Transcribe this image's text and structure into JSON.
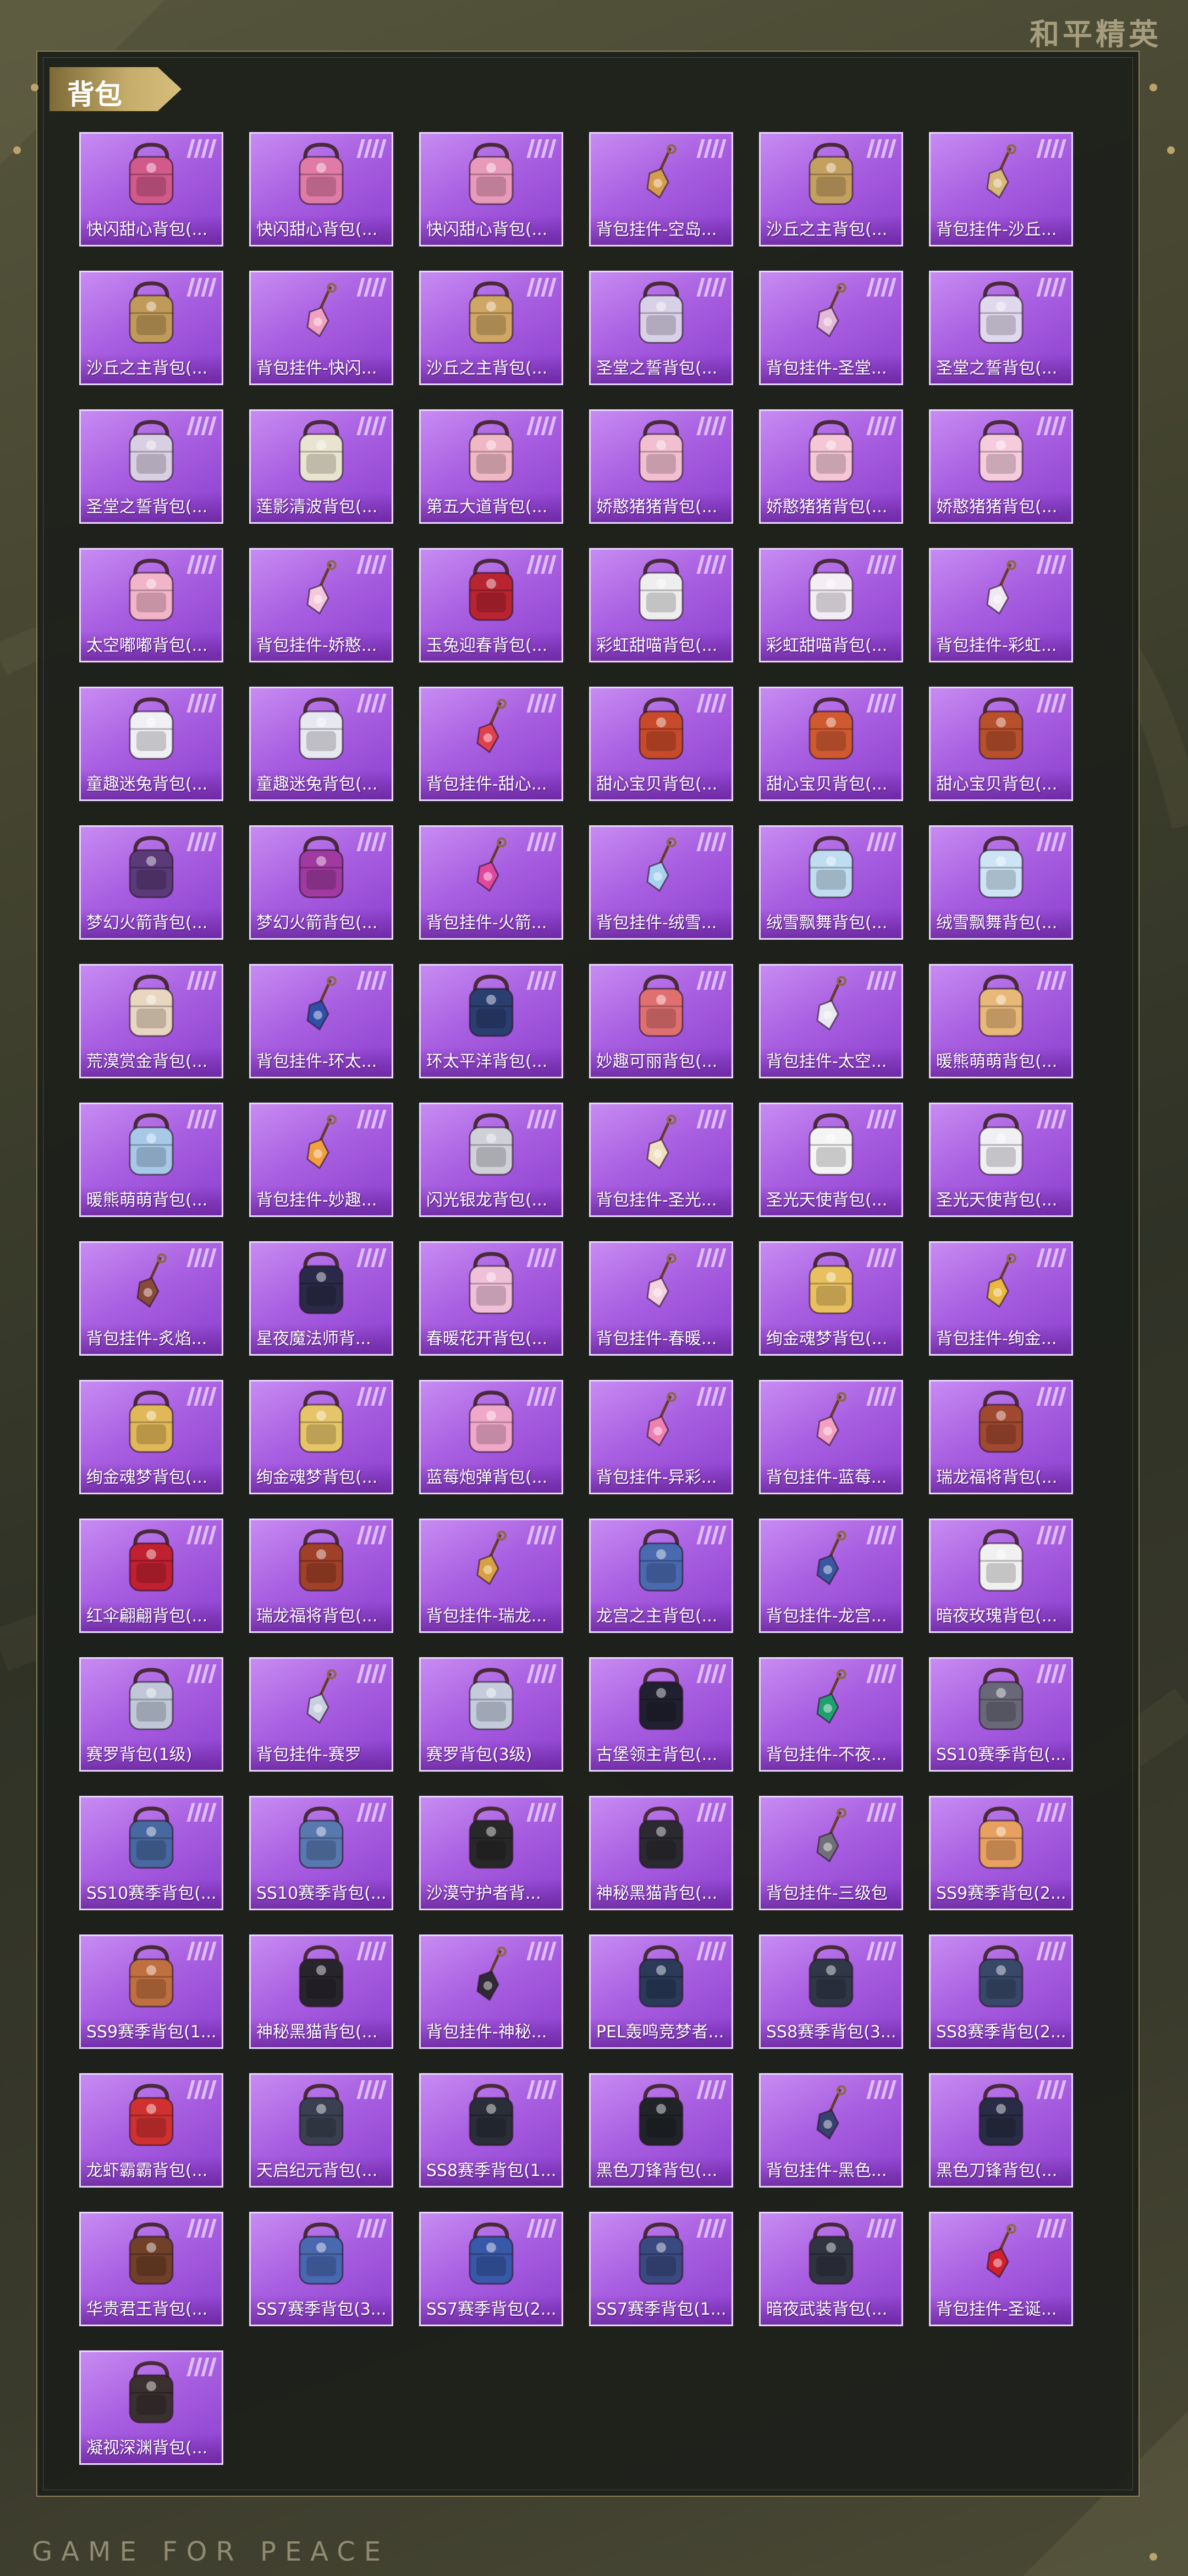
{
  "branding": {
    "top_logo": "和平精英",
    "bottom_logo": "GAME FOR PEACE"
  },
  "section": {
    "title": "背包"
  },
  "colors": {
    "card_top": "#c78cf2",
    "card_bottom": "#8c3fcf",
    "card_border": "#e9d6ff",
    "tab_gold": "#c7ad6b",
    "panel_bg": "#1c1f1a"
  },
  "items": [
    {
      "label": "快闪甜心背包(...",
      "icon": "backpack-icon",
      "color": "#d15a8a"
    },
    {
      "label": "快闪甜心背包(...",
      "icon": "backpack-icon",
      "color": "#e07aa6"
    },
    {
      "label": "快闪甜心背包(...",
      "icon": "backpack-icon",
      "color": "#e89ab9"
    },
    {
      "label": "背包挂件-空岛...",
      "icon": "pendant-icon",
      "color": "#d79b4d"
    },
    {
      "label": "沙丘之主背包(...",
      "icon": "backpack-icon",
      "color": "#c4a060"
    },
    {
      "label": "背包挂件-沙丘...",
      "icon": "pendant-icon",
      "color": "#d8b77a"
    },
    {
      "label": "沙丘之主背包(...",
      "icon": "backpack-icon",
      "color": "#c09a58"
    },
    {
      "label": "背包挂件-快闪...",
      "icon": "pendant-icon",
      "color": "#f0a0c0"
    },
    {
      "label": "沙丘之主背包(...",
      "icon": "backpack-icon",
      "color": "#cfa664"
    },
    {
      "label": "圣堂之誓背包(...",
      "icon": "backpack-icon",
      "color": "#d8d0e6"
    },
    {
      "label": "背包挂件-圣堂...",
      "icon": "pendant-icon",
      "color": "#e4b8d8"
    },
    {
      "label": "圣堂之誓背包(...",
      "icon": "backpack-icon",
      "color": "#e0d8ec"
    },
    {
      "label": "圣堂之誓背包(...",
      "icon": "backpack-icon",
      "color": "#d8cfe2"
    },
    {
      "label": "莲影清波背包(...",
      "icon": "backpack-icon",
      "color": "#e8e4d0"
    },
    {
      "label": "第五大道背包(...",
      "icon": "backpack-icon",
      "color": "#f0b8c4"
    },
    {
      "label": "娇憨猪猪背包(...",
      "icon": "backpack-icon",
      "color": "#f2bfd0"
    },
    {
      "label": "娇憨猪猪背包(...",
      "icon": "backpack-icon",
      "color": "#f4c6d6"
    },
    {
      "label": "娇憨猪猪背包(...",
      "icon": "backpack-icon",
      "color": "#f6ccdc"
    },
    {
      "label": "太空嘟嘟背包(...",
      "icon": "backpack-icon",
      "color": "#f2b4c8"
    },
    {
      "label": "背包挂件-娇憨...",
      "icon": "pendant-icon",
      "color": "#f4c8dc"
    },
    {
      "label": "玉兔迎春背包(...",
      "icon": "backpack-icon",
      "color": "#b82430"
    },
    {
      "label": "彩虹甜喵背包(...",
      "icon": "backpack-icon",
      "color": "#eeeeee"
    },
    {
      "label": "彩虹甜喵背包(...",
      "icon": "backpack-icon",
      "color": "#f4eef4"
    },
    {
      "label": "背包挂件-彩虹...",
      "icon": "pendant-icon",
      "color": "#f0e8f0"
    },
    {
      "label": "童趣迷兔背包(...",
      "icon": "backpack-icon",
      "color": "#f0f0f4"
    },
    {
      "label": "童趣迷兔背包(...",
      "icon": "backpack-icon",
      "color": "#e8e8f0"
    },
    {
      "label": "背包挂件-甜心...",
      "icon": "pendant-icon",
      "color": "#e04050"
    },
    {
      "label": "甜心宝贝背包(...",
      "icon": "backpack-icon",
      "color": "#c84a2a"
    },
    {
      "label": "甜心宝贝背包(...",
      "icon": "backpack-icon",
      "color": "#d05a30"
    },
    {
      "label": "甜心宝贝背包(...",
      "icon": "backpack-icon",
      "color": "#b8502c"
    },
    {
      "label": "梦幻火箭背包(...",
      "icon": "backpack-icon",
      "color": "#5a3a78"
    },
    {
      "label": "梦幻火箭背包(...",
      "icon": "backpack-icon",
      "color": "#a03aa0"
    },
    {
      "label": "背包挂件-火箭...",
      "icon": "pendant-icon",
      "color": "#e048a0"
    },
    {
      "label": "背包挂件-绒雪...",
      "icon": "pendant-icon",
      "color": "#a8d0f0"
    },
    {
      "label": "绒雪飘舞背包(...",
      "icon": "backpack-icon",
      "color": "#c0dcf0"
    },
    {
      "label": "绒雪飘舞背包(...",
      "icon": "backpack-icon",
      "color": "#cce4f4"
    },
    {
      "label": "荒漠赏金背包(...",
      "icon": "backpack-icon",
      "color": "#e8d6c0"
    },
    {
      "label": "背包挂件-环太...",
      "icon": "pendant-icon",
      "color": "#3050a8"
    },
    {
      "label": "环太平洋背包(...",
      "icon": "backpack-icon",
      "color": "#2a3e70"
    },
    {
      "label": "妙趣可丽背包(...",
      "icon": "backpack-icon",
      "color": "#e07070"
    },
    {
      "label": "背包挂件-太空...",
      "icon": "pendant-icon",
      "color": "#e8e8f0"
    },
    {
      "label": "暖熊萌萌背包(...",
      "icon": "backpack-icon",
      "color": "#e8b878"
    },
    {
      "label": "暖熊萌萌背包(...",
      "icon": "backpack-icon",
      "color": "#a8c8e8"
    },
    {
      "label": "背包挂件-妙趣...",
      "icon": "pendant-icon",
      "color": "#f0a040"
    },
    {
      "label": "闪光银龙背包(...",
      "icon": "backpack-icon",
      "color": "#d0d0d8"
    },
    {
      "label": "背包挂件-圣光...",
      "icon": "pendant-icon",
      "color": "#f0e0c0"
    },
    {
      "label": "圣光天使背包(...",
      "icon": "backpack-icon",
      "color": "#f4f4f4"
    },
    {
      "label": "圣光天使背包(...",
      "icon": "backpack-icon",
      "color": "#f0f0f4"
    },
    {
      "label": "背包挂件-炙焰...",
      "icon": "pendant-icon",
      "color": "#8a4a3a"
    },
    {
      "label": "星夜魔法师背...",
      "icon": "backpack-icon",
      "color": "#2a2a48"
    },
    {
      "label": "春暖花开背包(...",
      "icon": "backpack-icon",
      "color": "#f0c0d8"
    },
    {
      "label": "背包挂件-春暖...",
      "icon": "pendant-icon",
      "color": "#f4d0e0"
    },
    {
      "label": "绚金魂梦背包(...",
      "icon": "backpack-icon",
      "color": "#e8c060"
    },
    {
      "label": "背包挂件-绚金...",
      "icon": "pendant-icon",
      "color": "#e8b840"
    },
    {
      "label": "绚金魂梦背包(...",
      "icon": "backpack-icon",
      "color": "#e0b858"
    },
    {
      "label": "绚金魂梦背包(...",
      "icon": "backpack-icon",
      "color": "#e6c468"
    },
    {
      "label": "蓝莓炮弹背包(...",
      "icon": "backpack-icon",
      "color": "#f0a8c8"
    },
    {
      "label": "背包挂件-异彩...",
      "icon": "pendant-icon",
      "color": "#f080b0"
    },
    {
      "label": "背包挂件-蓝莓...",
      "icon": "pendant-icon",
      "color": "#f4a0c0"
    },
    {
      "label": "瑞龙福将背包(...",
      "icon": "backpack-icon",
      "color": "#a04830"
    },
    {
      "label": "红伞翩翩背包(...",
      "icon": "backpack-icon",
      "color": "#c02030"
    },
    {
      "label": "瑞龙福将背包(...",
      "icon": "backpack-icon",
      "color": "#a04028"
    },
    {
      "label": "背包挂件-瑞龙...",
      "icon": "pendant-icon",
      "color": "#d8a040"
    },
    {
      "label": "龙宫之主背包(...",
      "icon": "backpack-icon",
      "color": "#4a6ab0"
    },
    {
      "label": "背包挂件-龙宫...",
      "icon": "pendant-icon",
      "color": "#3a58a0"
    },
    {
      "label": "暗夜玫瑰背包(...",
      "icon": "backpack-icon",
      "color": "#f0f0f0"
    },
    {
      "label": "赛罗背包(1级)",
      "icon": "backpack-icon",
      "color": "#c0c8d8"
    },
    {
      "label": "背包挂件-赛罗",
      "icon": "pendant-icon",
      "color": "#c8d0e0"
    },
    {
      "label": "赛罗背包(3级)",
      "icon": "backpack-icon",
      "color": "#c4ccdc"
    },
    {
      "label": "古堡领主背包(...",
      "icon": "backpack-icon",
      "color": "#202030"
    },
    {
      "label": "背包挂件-不夜...",
      "icon": "pendant-icon",
      "color": "#20a070"
    },
    {
      "label": "SS10赛季背包(...",
      "icon": "backpack-icon",
      "color": "#686878"
    },
    {
      "label": "SS10赛季背包(...",
      "icon": "backpack-icon",
      "color": "#4868a0"
    },
    {
      "label": "SS10赛季背包(...",
      "icon": "backpack-icon",
      "color": "#5878b0"
    },
    {
      "label": "沙漠守护者背...",
      "icon": "backpack-icon",
      "color": "#282828"
    },
    {
      "label": "神秘黑猫背包(...",
      "icon": "backpack-icon",
      "color": "#2a2a30"
    },
    {
      "label": "背包挂件-三级包",
      "icon": "pendant-icon",
      "color": "#707078"
    },
    {
      "label": "SS9赛季背包(2...",
      "icon": "backpack-icon",
      "color": "#e8a060"
    },
    {
      "label": "SS9赛季背包(1...",
      "icon": "backpack-icon",
      "color": "#c07040"
    },
    {
      "label": "神秘黑猫背包(...",
      "icon": "backpack-icon",
      "color": "#28242c"
    },
    {
      "label": "背包挂件-神秘...",
      "icon": "pendant-icon",
      "color": "#302a34"
    },
    {
      "label": "PEL轰鸣竞梦者...",
      "icon": "backpack-icon",
      "color": "#2a3a58"
    },
    {
      "label": "SS8赛季背包(3...",
      "icon": "backpack-icon",
      "color": "#303848"
    },
    {
      "label": "SS8赛季背包(2...",
      "icon": "backpack-icon",
      "color": "#384868"
    },
    {
      "label": "龙虾霸霸背包(...",
      "icon": "backpack-icon",
      "color": "#d03030"
    },
    {
      "label": "天启纪元背包(...",
      "icon": "backpack-icon",
      "color": "#3a4050"
    },
    {
      "label": "SS8赛季背包(1...",
      "icon": "backpack-icon",
      "color": "#2a2e38"
    },
    {
      "label": "黑色刀锋背包(...",
      "icon": "backpack-icon",
      "color": "#202428"
    },
    {
      "label": "背包挂件-黑色...",
      "icon": "pendant-icon",
      "color": "#384070"
    },
    {
      "label": "黑色刀锋背包(...",
      "icon": "backpack-icon",
      "color": "#282c44"
    },
    {
      "label": "华贵君王背包(...",
      "icon": "backpack-icon",
      "color": "#704028"
    },
    {
      "label": "SS7赛季背包(3...",
      "icon": "backpack-icon",
      "color": "#4868b0"
    },
    {
      "label": "SS7赛季背包(2...",
      "icon": "backpack-icon",
      "color": "#3858a8"
    },
    {
      "label": "SS7赛季背包(1...",
      "icon": "backpack-icon",
      "color": "#3a4a80"
    },
    {
      "label": "暗夜武装背包(...",
      "icon": "backpack-icon",
      "color": "#303440"
    },
    {
      "label": "背包挂件-圣诞...",
      "icon": "pendant-icon",
      "color": "#d02030"
    },
    {
      "label": "凝视深渊背包(...",
      "icon": "backpack-icon",
      "color": "#3a3030"
    }
  ]
}
